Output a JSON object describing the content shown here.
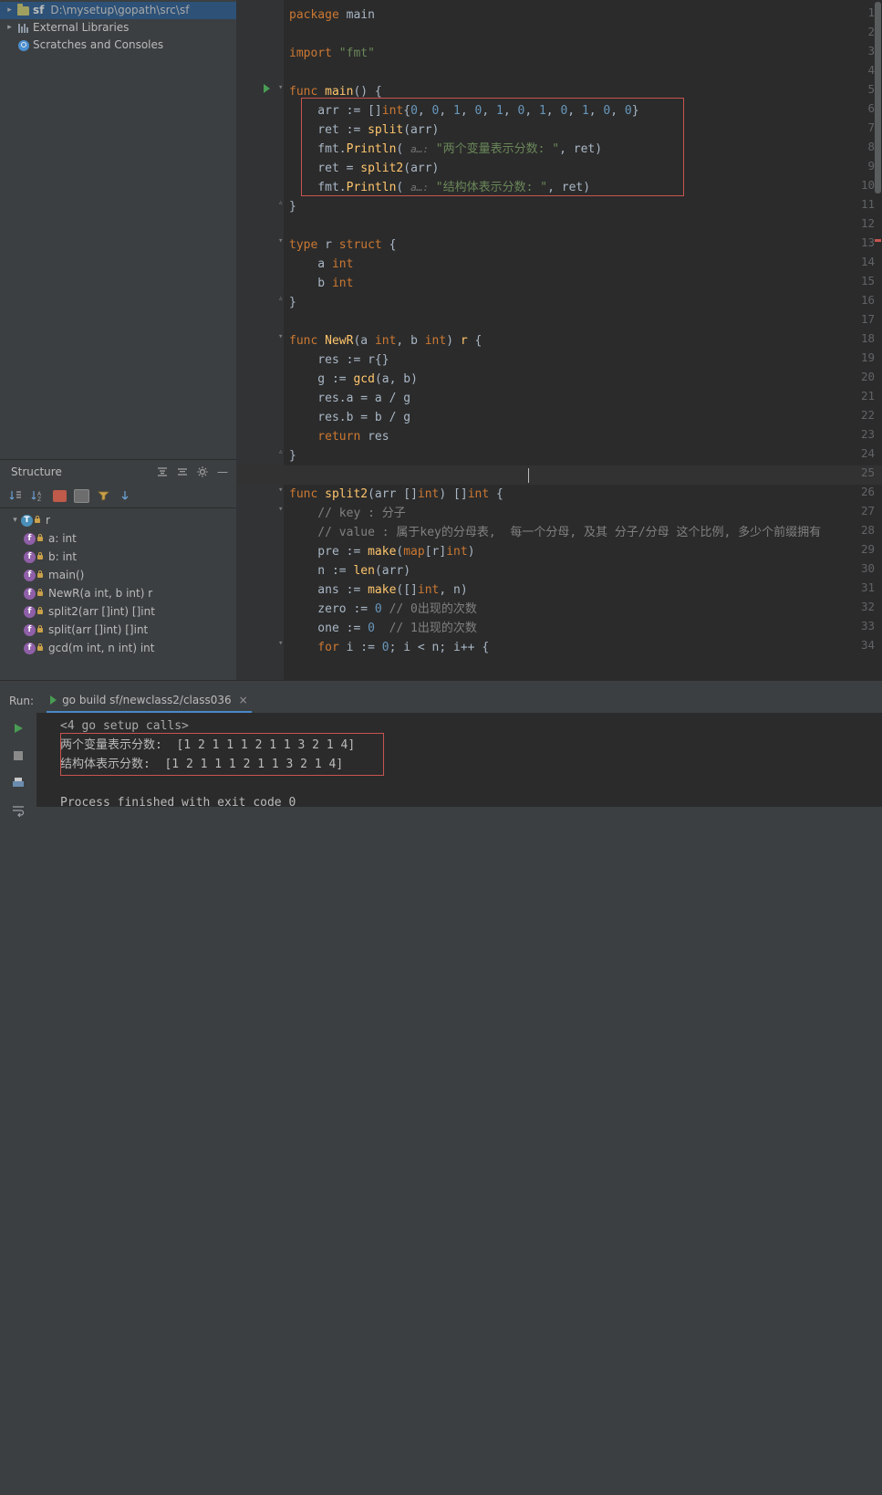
{
  "project": {
    "root": {
      "name": "sf",
      "path": "D:\\mysetup\\gopath\\src\\sf"
    },
    "items": [
      {
        "label": "External Libraries",
        "icon": "library-icon"
      },
      {
        "label": "Scratches and Consoles",
        "icon": "scratch-icon"
      }
    ]
  },
  "structure": {
    "title": "Structure",
    "items": [
      {
        "kind": "t",
        "label": "r",
        "indent": 0
      },
      {
        "kind": "f",
        "label": "a: int",
        "indent": 1
      },
      {
        "kind": "f",
        "label": "b: int",
        "indent": 1
      },
      {
        "kind": "m",
        "label": "main()",
        "indent": 0
      },
      {
        "kind": "m",
        "label": "NewR(a int, b int) r",
        "indent": 0
      },
      {
        "kind": "m",
        "label": "split2(arr []int) []int",
        "indent": 0
      },
      {
        "kind": "m",
        "label": "split(arr []int) []int",
        "indent": 0
      },
      {
        "kind": "m",
        "label": "gcd(m int, n int) int",
        "indent": 0
      }
    ]
  },
  "editor": {
    "first_line": 1,
    "caret_line": 25,
    "lines": [
      {
        "n": 1,
        "tokens": [
          [
            "kw",
            "package"
          ],
          [
            "pl",
            " main"
          ]
        ]
      },
      {
        "n": 2,
        "tokens": []
      },
      {
        "n": 3,
        "tokens": [
          [
            "kw",
            "import"
          ],
          [
            "pl",
            " "
          ],
          [
            "str",
            "\"fmt\""
          ]
        ]
      },
      {
        "n": 4,
        "tokens": []
      },
      {
        "n": 5,
        "tokens": [
          [
            "kw",
            "func"
          ],
          [
            "pl",
            " "
          ],
          [
            "fn",
            "main"
          ],
          [
            "pl",
            "() {"
          ]
        ]
      },
      {
        "n": 6,
        "tokens": [
          [
            "pl",
            "    arr := []"
          ],
          [
            "kw",
            "int"
          ],
          [
            "pl",
            "{"
          ],
          [
            "num",
            "0"
          ],
          [
            "pl",
            ", "
          ],
          [
            "num",
            "0"
          ],
          [
            "pl",
            ", "
          ],
          [
            "num",
            "1"
          ],
          [
            "pl",
            ", "
          ],
          [
            "num",
            "0"
          ],
          [
            "pl",
            ", "
          ],
          [
            "num",
            "1"
          ],
          [
            "pl",
            ", "
          ],
          [
            "num",
            "0"
          ],
          [
            "pl",
            ", "
          ],
          [
            "num",
            "1"
          ],
          [
            "pl",
            ", "
          ],
          [
            "num",
            "0"
          ],
          [
            "pl",
            ", "
          ],
          [
            "num",
            "1"
          ],
          [
            "pl",
            ", "
          ],
          [
            "num",
            "0"
          ],
          [
            "pl",
            ", "
          ],
          [
            "num",
            "0"
          ],
          [
            "pl",
            "}"
          ]
        ]
      },
      {
        "n": 7,
        "tokens": [
          [
            "pl",
            "    ret := "
          ],
          [
            "fn",
            "split"
          ],
          [
            "pl",
            "(arr)"
          ]
        ]
      },
      {
        "n": 8,
        "tokens": [
          [
            "pl",
            "    fmt."
          ],
          [
            "fn",
            "Println"
          ],
          [
            "pl",
            "( "
          ],
          [
            "hint",
            "a…:"
          ],
          [
            "pl",
            " "
          ],
          [
            "str",
            "\"两个变量表示分数: \""
          ],
          [
            "pl",
            ", ret)"
          ]
        ]
      },
      {
        "n": 9,
        "tokens": [
          [
            "pl",
            "    ret = "
          ],
          [
            "fn",
            "split2"
          ],
          [
            "pl",
            "(arr)"
          ]
        ]
      },
      {
        "n": 10,
        "tokens": [
          [
            "pl",
            "    fmt."
          ],
          [
            "fn",
            "Println"
          ],
          [
            "pl",
            "( "
          ],
          [
            "hint",
            "a…:"
          ],
          [
            "pl",
            " "
          ],
          [
            "str",
            "\"结构体表示分数: \""
          ],
          [
            "pl",
            ", ret)"
          ]
        ]
      },
      {
        "n": 11,
        "tokens": [
          [
            "pl",
            "}"
          ]
        ]
      },
      {
        "n": 12,
        "tokens": []
      },
      {
        "n": 13,
        "tokens": [
          [
            "kw",
            "type"
          ],
          [
            "pl",
            " r "
          ],
          [
            "kw",
            "struct"
          ],
          [
            "pl",
            " {"
          ]
        ]
      },
      {
        "n": 14,
        "tokens": [
          [
            "pl",
            "    a "
          ],
          [
            "kw",
            "int"
          ]
        ]
      },
      {
        "n": 15,
        "tokens": [
          [
            "pl",
            "    b "
          ],
          [
            "kw",
            "int"
          ]
        ]
      },
      {
        "n": 16,
        "tokens": [
          [
            "pl",
            "}"
          ]
        ]
      },
      {
        "n": 17,
        "tokens": []
      },
      {
        "n": 18,
        "tokens": [
          [
            "kw",
            "func"
          ],
          [
            "pl",
            " "
          ],
          [
            "fn",
            "NewR"
          ],
          [
            "pl",
            "(a "
          ],
          [
            "kw",
            "int"
          ],
          [
            "pl",
            ", b "
          ],
          [
            "kw",
            "int"
          ],
          [
            "pl",
            ") "
          ],
          [
            "typ2",
            "r"
          ],
          [
            "pl",
            " {"
          ]
        ]
      },
      {
        "n": 19,
        "tokens": [
          [
            "pl",
            "    res := r{}"
          ]
        ]
      },
      {
        "n": 20,
        "tokens": [
          [
            "pl",
            "    g := "
          ],
          [
            "fn",
            "gcd"
          ],
          [
            "pl",
            "(a, b)"
          ]
        ]
      },
      {
        "n": 21,
        "tokens": [
          [
            "pl",
            "    res.a = a / g"
          ]
        ]
      },
      {
        "n": 22,
        "tokens": [
          [
            "pl",
            "    res.b = b / g"
          ]
        ]
      },
      {
        "n": 23,
        "tokens": [
          [
            "kw",
            "    return"
          ],
          [
            "pl",
            " res"
          ]
        ]
      },
      {
        "n": 24,
        "tokens": [
          [
            "pl",
            "}"
          ]
        ]
      },
      {
        "n": 25,
        "tokens": []
      },
      {
        "n": 26,
        "tokens": [
          [
            "kw",
            "func"
          ],
          [
            "pl",
            " "
          ],
          [
            "fn",
            "split2"
          ],
          [
            "pl",
            "(arr []"
          ],
          [
            "kw",
            "int"
          ],
          [
            "pl",
            ") []"
          ],
          [
            "kw",
            "int"
          ],
          [
            "pl",
            " {"
          ]
        ]
      },
      {
        "n": 27,
        "tokens": [
          [
            "cm",
            "    // key : 分子"
          ]
        ]
      },
      {
        "n": 28,
        "tokens": [
          [
            "cm",
            "    // value : 属于key的分母表,  每一个分母, 及其 分子/分母 这个比例, 多少个前缀拥有"
          ]
        ]
      },
      {
        "n": 29,
        "tokens": [
          [
            "pl",
            "    pre := "
          ],
          [
            "fn",
            "make"
          ],
          [
            "pl",
            "("
          ],
          [
            "kw",
            "map"
          ],
          [
            "pl",
            "[r]"
          ],
          [
            "kw",
            "int"
          ],
          [
            "pl",
            ")"
          ]
        ]
      },
      {
        "n": 30,
        "tokens": [
          [
            "pl",
            "    n := "
          ],
          [
            "fn",
            "len"
          ],
          [
            "pl",
            "(arr)"
          ]
        ]
      },
      {
        "n": 31,
        "tokens": [
          [
            "pl",
            "    ans := "
          ],
          [
            "fn",
            "make"
          ],
          [
            "pl",
            "([]"
          ],
          [
            "kw",
            "int"
          ],
          [
            "pl",
            ", n)"
          ]
        ]
      },
      {
        "n": 32,
        "tokens": [
          [
            "pl",
            "    zero := "
          ],
          [
            "num",
            "0"
          ],
          [
            "pl",
            " "
          ],
          [
            "cm",
            "// 0出现的次数"
          ]
        ]
      },
      {
        "n": 33,
        "tokens": [
          [
            "pl",
            "    one := "
          ],
          [
            "num",
            "0"
          ],
          [
            "pl",
            "  "
          ],
          [
            "cm",
            "// 1出现的次数"
          ]
        ]
      },
      {
        "n": 34,
        "tokens": [
          [
            "kw",
            "    for"
          ],
          [
            "pl",
            " i := "
          ],
          [
            "num",
            "0"
          ],
          [
            "pl",
            "; i < n; i++ {"
          ]
        ]
      }
    ]
  },
  "run": {
    "label": "Run:",
    "tab_name": "go build sf/newclass2/class036",
    "console": [
      "<4 go setup calls>",
      "两个变量表示分数:  [1 2 1 1 1 2 1 1 3 2 1 4]",
      "结构体表示分数:  [1 2 1 1 1 2 1 1 3 2 1 4]",
      "",
      "Process finished with exit code 0"
    ]
  },
  "colors": {
    "accent": "#4a88c7",
    "selection": "#2d5177",
    "error": "#c75450",
    "keyword": "#cc7832",
    "string": "#6a8759",
    "number": "#6897bb",
    "function": "#ffc66d"
  }
}
